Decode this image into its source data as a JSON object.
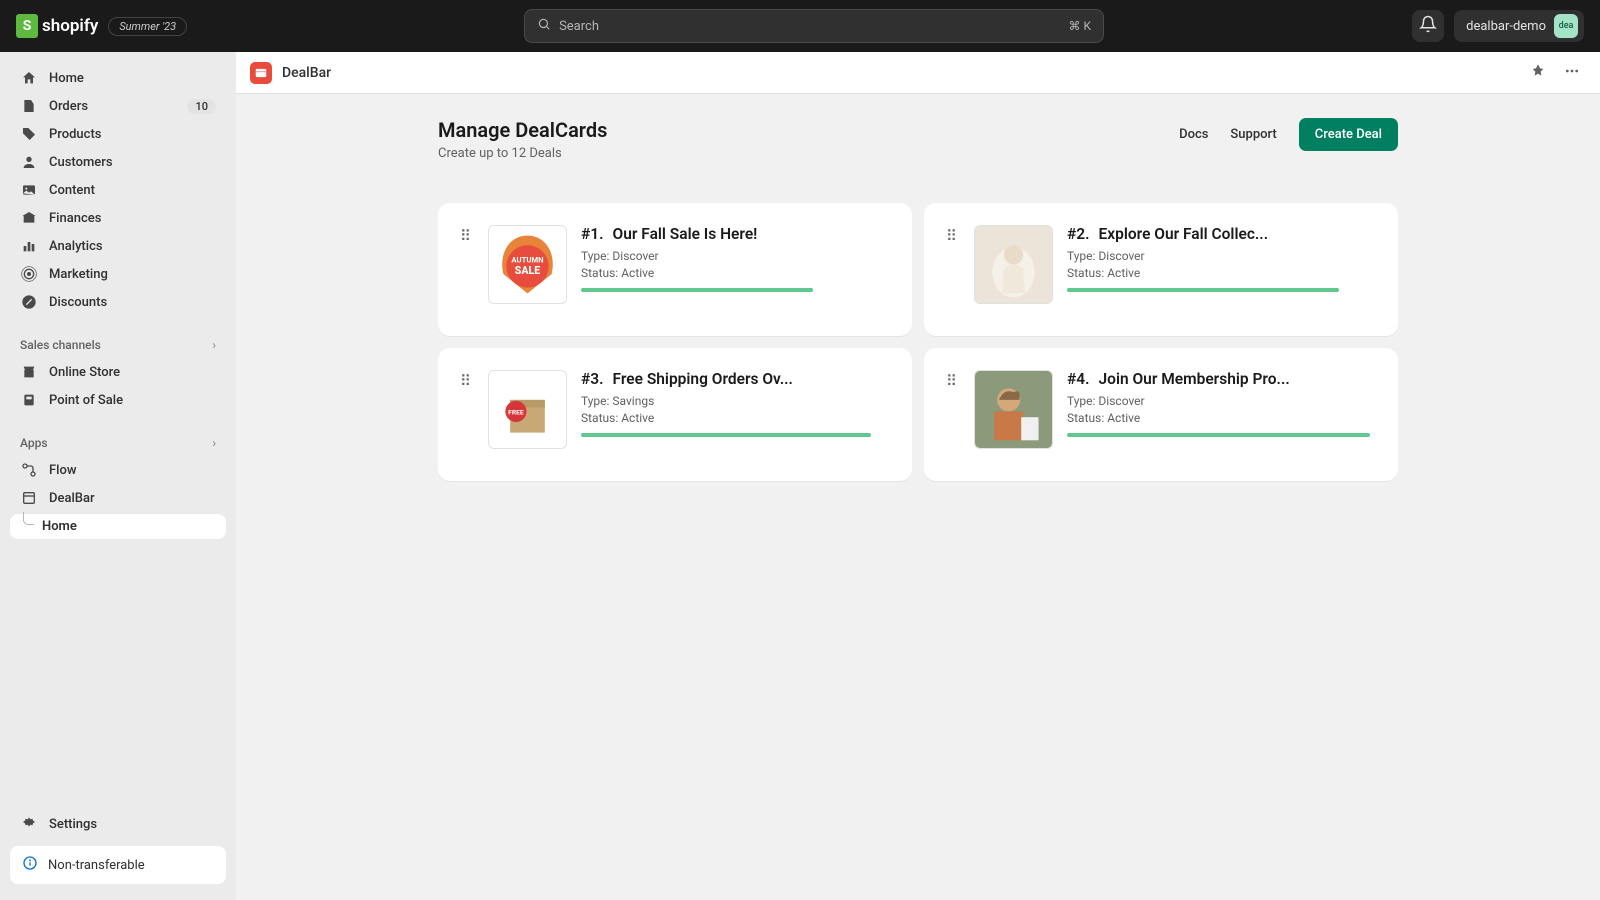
{
  "topbar": {
    "logo_text": "shopify",
    "summer_badge": "Summer '23",
    "search_placeholder": "Search",
    "search_kbd": "⌘ K",
    "store_name": "dealbar-demo",
    "avatar_short": "dea"
  },
  "sidebar": {
    "items": [
      {
        "label": "Home",
        "icon": "home"
      },
      {
        "label": "Orders",
        "icon": "orders",
        "badge": "10"
      },
      {
        "label": "Products",
        "icon": "products"
      },
      {
        "label": "Customers",
        "icon": "customers"
      },
      {
        "label": "Content",
        "icon": "content"
      },
      {
        "label": "Finances",
        "icon": "finances"
      },
      {
        "label": "Analytics",
        "icon": "analytics"
      },
      {
        "label": "Marketing",
        "icon": "marketing"
      },
      {
        "label": "Discounts",
        "icon": "discounts"
      }
    ],
    "sales_channels_header": "Sales channels",
    "channels": [
      {
        "label": "Online Store"
      },
      {
        "label": "Point of Sale"
      }
    ],
    "apps_header": "Apps",
    "apps": [
      {
        "label": "Flow"
      },
      {
        "label": "DealBar",
        "sub": "Home"
      }
    ],
    "settings_label": "Settings",
    "nontransferable_label": "Non-transferable"
  },
  "app_header": {
    "name": "DealBar"
  },
  "page": {
    "title": "Manage DealCards",
    "subtitle": "Create up to 12 Deals",
    "docs_label": "Docs",
    "support_label": "Support",
    "create_label": "Create Deal"
  },
  "deals": [
    {
      "num": "#1.",
      "title": "Our Fall Sale Is Here!",
      "type_label": "Type:",
      "type": "Discover",
      "status_label": "Status:",
      "status": "Active"
    },
    {
      "num": "#2.",
      "title": "Explore Our Fall Collec...",
      "type_label": "Type:",
      "type": "Discover",
      "status_label": "Status:",
      "status": "Active"
    },
    {
      "num": "#3.",
      "title": "Free Shipping Orders Ov...",
      "type_label": "Type:",
      "type": "Savings",
      "status_label": "Status:",
      "status": "Active"
    },
    {
      "num": "#4.",
      "title": "Join Our Membership Pro...",
      "type_label": "Type:",
      "type": "Discover",
      "status_label": "Status:",
      "status": "Active"
    }
  ]
}
